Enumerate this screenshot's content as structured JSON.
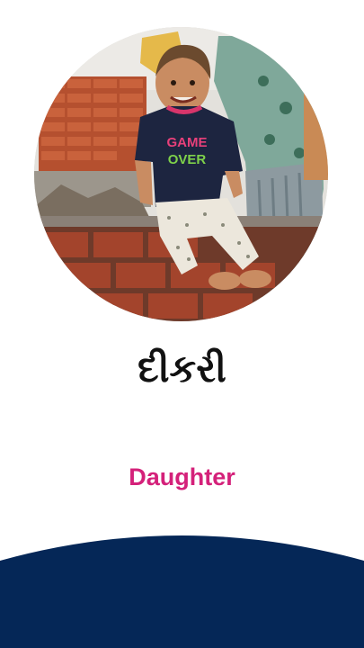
{
  "card": {
    "word_gujarati": "દીકરી",
    "word_english": "Daughter",
    "shirt_text_line1": "GAME",
    "shirt_text_line2": "OVER"
  },
  "colors": {
    "english_word": "#d4217a",
    "wave_fill": "#052757",
    "background": "#ffffff"
  },
  "icons": {
    "photo": "child-sitting-on-brick-wall-photo"
  }
}
